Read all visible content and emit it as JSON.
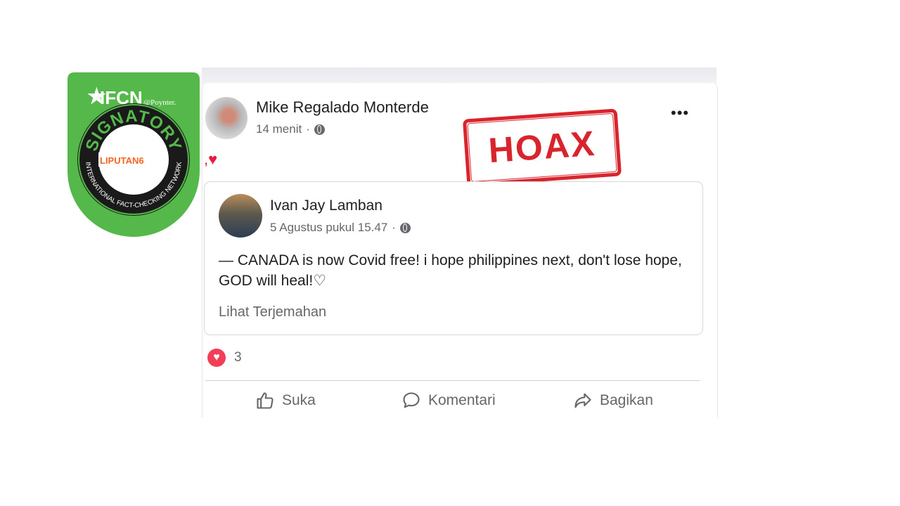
{
  "badge": {
    "ifcn_text": "IFCN",
    "poynter_text": "@Poynter.",
    "signatory_text": "SIGNATORY",
    "network_text": "INTERNATIONAL FACT-CHECKING NETWORK",
    "org_logo_text": "LIPUTAN6",
    "colors": {
      "green": "#55b84a",
      "ring": "#1a1a1a",
      "orange": "#f26522"
    }
  },
  "post": {
    "author_name": "Mike Regalado Monterde",
    "time": "14 menit",
    "separator": "·",
    "more_label": "•••",
    "reaction_text": ",♥"
  },
  "stamp": {
    "text": "HOAX",
    "color": "#d8242c"
  },
  "shared_post": {
    "author_name": "Ivan Jay Lamban",
    "time": "5 Agustus pukul 15.47",
    "separator": "·",
    "text": "— CANADA is now Covid free! i hope philippines next, don't lose hope, GOD will heal!♡",
    "translate_label": "Lihat Terjemahan"
  },
  "reactions": {
    "icon": "love-icon",
    "count": "3"
  },
  "actions": {
    "like_label": "Suka",
    "comment_label": "Komentari",
    "share_label": "Bagikan"
  }
}
